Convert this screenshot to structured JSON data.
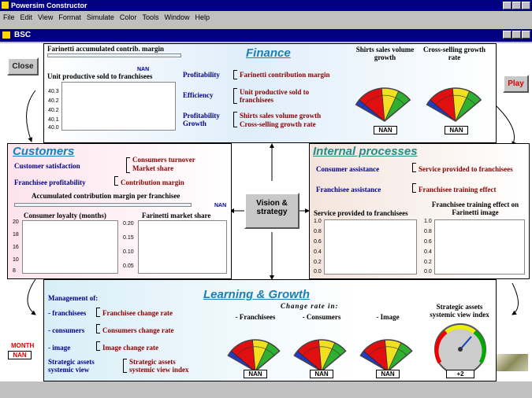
{
  "app": {
    "title": "Powersim Constructor",
    "menu": [
      "File",
      "Edit",
      "View",
      "Format",
      "Simulate",
      "Color",
      "Tools",
      "Window",
      "Help"
    ],
    "child_title": "BSC"
  },
  "buttons": {
    "close": "Close",
    "play": "Play",
    "vision": "Vision & strategy"
  },
  "finance": {
    "header": "Finance",
    "accum_label": "Farinetti accumulated contrib. margin",
    "nan": "NAN",
    "graph_title": "Unit productive sold to franchisees",
    "ticks": [
      "40.3",
      "40.2",
      "40.2",
      "40.1",
      "40.0"
    ],
    "objectives": [
      {
        "label": "Profitability",
        "measures": [
          "Farinetti contribution margin"
        ]
      },
      {
        "label": "Efficiency",
        "measures": [
          "Unit productive sold to franchisees"
        ]
      },
      {
        "label": "Profitability Growth",
        "measures": [
          "Shirts sales volume growth",
          "Cross-selling growth rate"
        ]
      }
    ],
    "gauges": [
      {
        "title": "Shirts sales volume growth",
        "value": "NAN"
      },
      {
        "title": "Cross-selling growth rate",
        "value": "NAN"
      }
    ]
  },
  "customers": {
    "header": "Customers",
    "objectives": [
      {
        "label": "Customer satisfaction",
        "measures": [
          "Consumers turnover",
          "Market share"
        ]
      },
      {
        "label": "Franchisee profitability",
        "measures": [
          "Contribution margin"
        ]
      }
    ],
    "accum_label": "Accumulated contribution margin per franchisee",
    "nan": "NAN",
    "graph1": {
      "title": "Consumer loyalty (months)",
      "ticks": [
        "20",
        "18",
        "16",
        "10",
        "8"
      ]
    },
    "graph2": {
      "title": "Farinetti market share",
      "ticks": [
        "0.20",
        "0.15",
        "0.10",
        "0.05"
      ]
    }
  },
  "internal": {
    "header": "Internal processes",
    "objectives": [
      {
        "label": "Consumer assistance",
        "measures": [
          "Service provided to franchisees"
        ]
      },
      {
        "label": "Franchisee assistance",
        "measures": [
          "Franchisee training effect"
        ]
      }
    ],
    "graph1": {
      "title": "Service provided to franchisees",
      "ticks": [
        "1.0",
        "0.8",
        "0.6",
        "0.4",
        "0.2",
        "0.0"
      ]
    },
    "graph2": {
      "title": "Franchisee training effect on Farinetti image",
      "ticks": [
        "1.0",
        "0.8",
        "0.6",
        "0.4",
        "0.2",
        "0.0"
      ]
    }
  },
  "learning": {
    "header": "Learning & Growth",
    "mgmt_title": "Management of:",
    "rows": [
      {
        "label": "- franchisees",
        "measure": "Franchisee change rate"
      },
      {
        "label": "- consumers",
        "measure": "Consumers change rate"
      },
      {
        "label": "- image",
        "measure": "Image change rate"
      },
      {
        "label": "Strategic assets systemic view",
        "measure": "Strategic assets systemic view index"
      }
    ],
    "change_title": "Change rate in:",
    "gauges": [
      {
        "title": "- Franchisees",
        "value": "NAN"
      },
      {
        "title": "- Consumers",
        "value": "NAN"
      },
      {
        "title": "- Image",
        "value": "NAN"
      }
    ],
    "dial": {
      "title": "Strategic assets systemic view index",
      "value": "+2"
    }
  },
  "month": {
    "label": "MONTH",
    "value": "NAN"
  },
  "colors": {
    "title_bar": "#000080",
    "finance_bg": "#dfeefa",
    "customers_bg": "#fde3ec",
    "internal_bg": "#f4e4dc",
    "learning_bg": "#d8eef7"
  }
}
